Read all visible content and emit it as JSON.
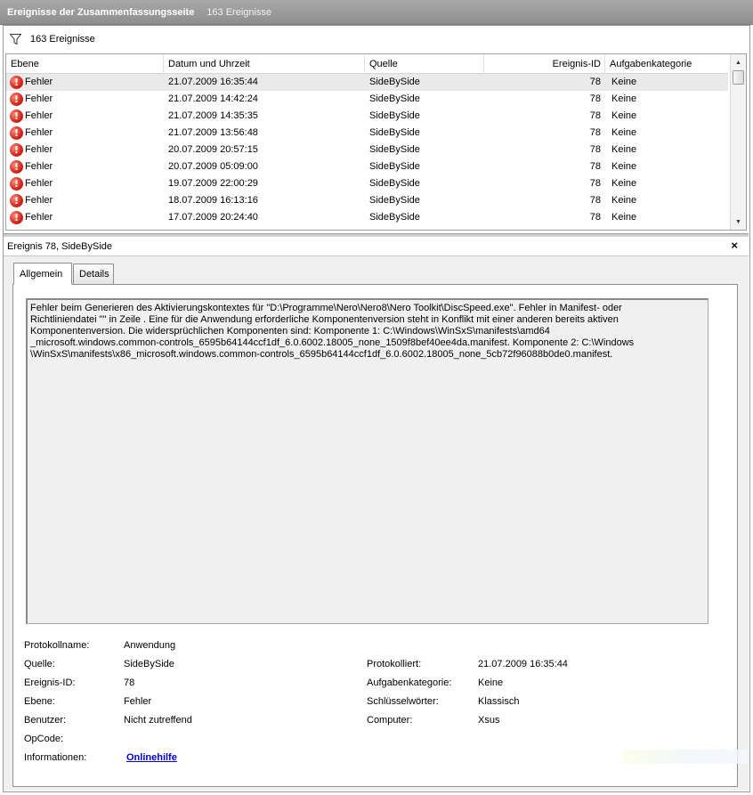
{
  "title": {
    "text": "Ereignisse der Zusammenfassungsseite",
    "count": "163 Ereignisse"
  },
  "filter": {
    "label": "163 Ereignisse",
    "icon": "filter-icon"
  },
  "grid": {
    "columns": [
      "Ebene",
      "Datum und Uhrzeit",
      "Quelle",
      "Ereignis-ID",
      "Aufgabenkategorie"
    ],
    "rows": [
      {
        "level": "Fehler",
        "datetime": "21.07.2009 16:35:44",
        "source": "SideBySide",
        "id": "78",
        "category": "Keine"
      },
      {
        "level": "Fehler",
        "datetime": "21.07.2009 14:42:24",
        "source": "SideBySide",
        "id": "78",
        "category": "Keine"
      },
      {
        "level": "Fehler",
        "datetime": "21.07.2009 14:35:35",
        "source": "SideBySide",
        "id": "78",
        "category": "Keine"
      },
      {
        "level": "Fehler",
        "datetime": "21.07.2009 13:56:48",
        "source": "SideBySide",
        "id": "78",
        "category": "Keine"
      },
      {
        "level": "Fehler",
        "datetime": "20.07.2009 20:57:15",
        "source": "SideBySide",
        "id": "78",
        "category": "Keine"
      },
      {
        "level": "Fehler",
        "datetime": "20.07.2009 05:09:00",
        "source": "SideBySide",
        "id": "78",
        "category": "Keine"
      },
      {
        "level": "Fehler",
        "datetime": "19.07.2009 22:00:29",
        "source": "SideBySide",
        "id": "78",
        "category": "Keine"
      },
      {
        "level": "Fehler",
        "datetime": "18.07.2009 16:13:16",
        "source": "SideBySide",
        "id": "78",
        "category": "Keine"
      },
      {
        "level": "Fehler",
        "datetime": "17.07.2009 20:24:40",
        "source": "SideBySide",
        "id": "78",
        "category": "Keine"
      }
    ]
  },
  "detail": {
    "header": "Ereignis 78, SideBySide",
    "close_glyph": "×",
    "tabs": [
      "Allgemein",
      "Details"
    ],
    "message_lines": [
      "Fehler beim Generieren des Aktivierungskontextes für \"D:\\Programme\\Nero\\Nero8\\Nero Toolkit\\DiscSpeed.exe\". Fehler in Manifest- oder",
      "Richtliniendatei \"\" in Zeile . Eine für die Anwendung erforderliche Komponentenversion steht in Konflikt mit einer anderen bereits aktiven",
      "Komponentenversion. Die widersprüchlichen Komponenten sind: Komponente 1: C:\\Windows\\WinSxS\\manifests\\amd64",
      "_microsoft.windows.common-controls_6595b64144ccf1df_6.0.6002.18005_none_1509f8bef40ee4da.manifest. Komponente 2: C:\\Windows",
      "\\WinSxS\\manifests\\x86_microsoft.windows.common-controls_6595b64144ccf1df_6.0.6002.18005_none_5cb72f96088b0de0.manifest."
    ],
    "props": {
      "protokollname_label": "Protokollname:",
      "protokollname": "Anwendung",
      "quelle_label": "Quelle:",
      "quelle": "SideBySide",
      "protokolliert_label": "Protokolliert:",
      "protokolliert": "21.07.2009 16:35:44",
      "ereignisid_label": "Ereignis-ID:",
      "ereignisid": "78",
      "aufgabenkategorie_label": "Aufgabenkategorie:",
      "aufgabenkategorie": "Keine",
      "ebene_label": "Ebene:",
      "ebene": "Fehler",
      "schluesselwoerter_label": "Schlüsselwörter:",
      "schluesselwoerter": "Klassisch",
      "benutzer_label": "Benutzer:",
      "benutzer": "Nicht zutreffend",
      "computer_label": "Computer:",
      "computer": "Xsus",
      "opcode_label": "OpCode:",
      "opcode": "",
      "informationen_label": "Informationen:",
      "informationen_link": "Onlinehilfe"
    }
  }
}
